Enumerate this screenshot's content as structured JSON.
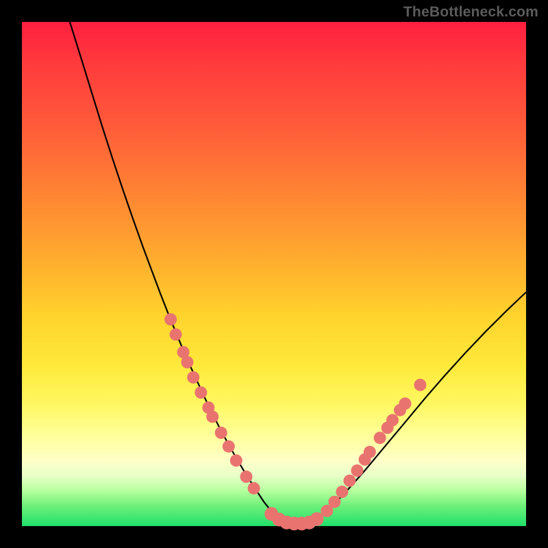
{
  "watermark": "TheBottleneck.com",
  "colors": {
    "frame": "#000000",
    "curve_stroke": "#000000",
    "marker_fill": "#e9736f",
    "gradient_stops": [
      "#ff1f3f",
      "#ff593a",
      "#ffa92f",
      "#ffe93a",
      "#ffff9a",
      "#6df07a",
      "#1fe06a"
    ]
  },
  "chart_data": {
    "type": "line",
    "title": "",
    "xlabel": "",
    "ylabel": "",
    "xlim": [
      0,
      100
    ],
    "ylim": [
      0,
      100
    ],
    "x": [
      9.5,
      12,
      14,
      16,
      18,
      20,
      22,
      24,
      26,
      27.5,
      29,
      30.5,
      32,
      33.5,
      35,
      36,
      37,
      38,
      39,
      40,
      41,
      42,
      43,
      44,
      45,
      46,
      48,
      50,
      53,
      56,
      60,
      64,
      68,
      72,
      76,
      80,
      84,
      88,
      92,
      96,
      100
    ],
    "values": [
      100,
      92,
      85.5,
      79,
      72.8,
      66.8,
      61,
      55.4,
      50,
      46,
      42.2,
      38.5,
      34.9,
      31.5,
      28.2,
      26,
      23.9,
      21.9,
      19.9,
      18,
      16.2,
      14.4,
      12.7,
      11,
      9.4,
      7.8,
      4.8,
      2.3,
      0.5,
      0.5,
      2.5,
      6.5,
      11,
      15.8,
      20.6,
      25.4,
      30,
      34.4,
      38.6,
      42.6,
      46.4
    ],
    "flat_bottom_x": [
      52,
      57
    ],
    "markers": {
      "left_cluster": [
        {
          "x": 29.5,
          "y": 41
        },
        {
          "x": 30.5,
          "y": 38
        },
        {
          "x": 32.0,
          "y": 34.5
        },
        {
          "x": 32.8,
          "y": 32.5
        },
        {
          "x": 34.0,
          "y": 29.5
        },
        {
          "x": 35.5,
          "y": 26.5
        },
        {
          "x": 37.0,
          "y": 23.5
        },
        {
          "x": 37.8,
          "y": 21.7
        },
        {
          "x": 39.5,
          "y": 18.5
        },
        {
          "x": 41.0,
          "y": 15.8
        },
        {
          "x": 42.5,
          "y": 13.0
        },
        {
          "x": 44.5,
          "y": 9.8
        },
        {
          "x": 46.0,
          "y": 7.5
        }
      ],
      "bottom_cluster": [
        {
          "x": 49.5,
          "y": 2.4
        },
        {
          "x": 51.0,
          "y": 1.3
        },
        {
          "x": 52.5,
          "y": 0.7
        },
        {
          "x": 54.0,
          "y": 0.5
        },
        {
          "x": 55.5,
          "y": 0.5
        },
        {
          "x": 57.0,
          "y": 0.7
        },
        {
          "x": 58.5,
          "y": 1.4
        }
      ],
      "right_cluster": [
        {
          "x": 60.5,
          "y": 3.0
        },
        {
          "x": 62.0,
          "y": 4.8
        },
        {
          "x": 63.5,
          "y": 6.8
        },
        {
          "x": 65.0,
          "y": 9.0
        },
        {
          "x": 66.5,
          "y": 11.0
        },
        {
          "x": 68.0,
          "y": 13.2
        },
        {
          "x": 69.0,
          "y": 14.7
        },
        {
          "x": 71.0,
          "y": 17.5
        },
        {
          "x": 72.5,
          "y": 19.5
        },
        {
          "x": 73.5,
          "y": 21.0
        },
        {
          "x": 75.0,
          "y": 23.0
        },
        {
          "x": 76.0,
          "y": 24.3
        },
        {
          "x": 79.0,
          "y": 28.0
        }
      ]
    }
  }
}
